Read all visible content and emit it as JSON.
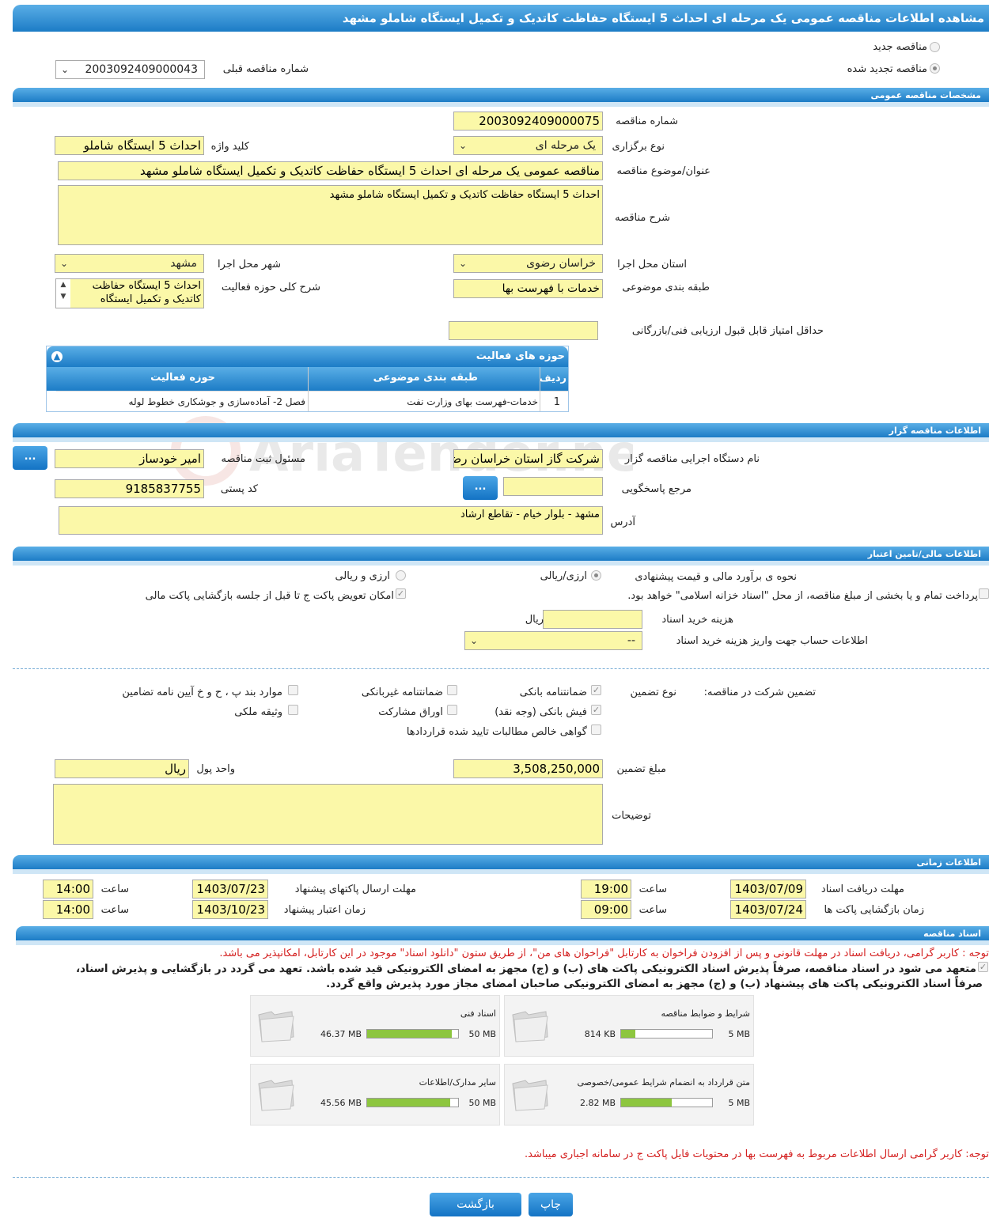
{
  "header": {
    "title": "مشاهده اطلاعات مناقصه عمومی یک مرحله ای احداث 5 ایستگاه حفاظت کاتدیک و تکمیل ایستگاه شاملو مشهد"
  },
  "top": {
    "new_tender": "مناقصه جدید",
    "renewed_tender": "مناقصه تجدید شده",
    "prev_number_label": "شماره مناقصه قبلی",
    "prev_number_value": "2003092409000043"
  },
  "general": {
    "section_title": "مشخصات مناقصه عمومی",
    "number_label": "شماره مناقصه",
    "number_value": "2003092409000075",
    "type_label": "نوع برگزاری",
    "type_value": "یک مرحله ای",
    "keyword_label": "کلید واژه",
    "keyword_value": "احداث 5 ایستگاه شاملو",
    "subject_label": "عنوان/موضوع مناقصه",
    "subject_value": "مناقصه عمومی یک مرحله ای احداث 5 ایستگاه حفاظت کاتدیک و تکمیل ایستگاه شاملو مشهد",
    "desc_label": "شرح مناقصه",
    "desc_value": "احداث 5 ایستگاه حفاظت کاتدیک و تکمیل ایستگاه شاملو مشهد",
    "province_label": "استان محل اجرا",
    "province_value": "خراسان رضوی",
    "city_label": "شهر محل اجرا",
    "city_value": "مشهد",
    "category_label": "طبقه بندی موضوعی",
    "category_value": "خدمات با فهرست بها",
    "activity_desc_label": "شرح کلی حوزه فعالیت",
    "activity_desc_value": "احداث 5 ایستگاه حفاظت کاتدیک و تکمیل ایستگاه",
    "min_score_label": "حداقل امتیاز قابل قبول ارزیابی فنی/بازرگانی"
  },
  "activity_grid": {
    "title": "حوزه های فعالیت",
    "headers": [
      "ردیف",
      "طبقه بندی موضوعی",
      "حوزه فعالیت"
    ],
    "rows": [
      [
        "1",
        "خدمات-فهرست بهای وزارت نفت",
        "فصل 2- آماده‌سازی و جوشکاری خطوط لوله"
      ]
    ]
  },
  "organizer": {
    "section_title": "اطلاعات مناقصه گزار",
    "org_label": "نام دستگاه اجرایی مناقصه گزار",
    "org_value": "شرکت گاز استان خراسان رضوی",
    "responsible_label": "مسئول ثبت مناقصه",
    "responsible_value": "امیر خودساز",
    "ref_label": "مرجع پاسخگویی",
    "postal_label": "کد پستی",
    "postal_value": "9185837755",
    "address_label": "آدرس",
    "address_value": "مشهد - بلوار خیام - تقاطع ارشاد",
    "dots": "..."
  },
  "financial": {
    "section_title": "اطلاعات مالی/تامین اعتبار",
    "estimate_label": "نحوه ی برآورد مالی و قیمت پیشنهادی",
    "opt_rial": "ارزی/ریالی",
    "opt_currency": "ارزی و ریالی",
    "treasury_text": "پرداخت تمام و یا بخشی از مبلغ مناقصه، از محل \"اسناد خزانه اسلامی\" خواهد بود.",
    "swap_text": "امکان تعویض پاکت ج تا قبل از جلسه بازگشایی پاکت مالی",
    "doc_cost_label": "هزینه خرید اسناد",
    "doc_cost_unit": "ریال",
    "account_label": "اطلاعات حساب جهت واریز هزینه خرید اسناد",
    "account_value": "--"
  },
  "guarantee": {
    "label": "تضمین شرکت در مناقصه:",
    "type_label": "نوع تضمین",
    "bank_guarantee": "ضمانتنامه بانکی",
    "non_bank_guarantee": "ضمانتنامه غیربانکی",
    "clauses": "موارد بند پ ، ح و خ آیین نامه تضامین",
    "bank_receipt": "فیش بانکی (وجه نقد)",
    "bonds": "اوراق مشارکت",
    "property": "وثیقه ملکی",
    "certificate": "گواهی خالص مطالبات تایید شده قراردادها",
    "amount_label": "مبلغ تضمین",
    "amount_value": "3,508,250,000",
    "currency_label": "واحد پول",
    "currency_value": "ریال",
    "notes_label": "توضیحات"
  },
  "timing": {
    "section_title": "اطلاعات زمانی",
    "doc_receive_label": "مهلت دریافت اسناد",
    "doc_receive_date": "1403/07/09",
    "doc_receive_time": "19:00",
    "submit_label": "مهلت ارسال پاکتهای پیشنهاد",
    "submit_date": "1403/07/23",
    "submit_time": "14:00",
    "opening_label": "زمان بازگشایی پاکت ها",
    "opening_date": "1403/07/24",
    "opening_time": "09:00",
    "validity_label": "زمان اعتبار پیشنهاد",
    "validity_date": "1403/10/23",
    "validity_time": "14:00",
    "time_label": "ساعت"
  },
  "documents": {
    "section_title": "اسناد مناقصه",
    "notice": "توجه : کاربر گرامی، دریافت اسناد در مهلت قانونی و پس از افزودن فراخوان به کارتابل \"فراخوان های من\"، از طریق ستون \"دانلود اسناد\" موجود در این کارتابل، امکانپذیر می باشد.",
    "commit_line1": "متعهد می شود در اسناد مناقصه، صرفاً پذیرش اسناد الکترونیکی پاکت های (ب) و (ج) مجهز به امضای الکترونیکی قید شده باشد. تعهد می گردد در بازگشایی و پذیرش اسناد،",
    "commit_line2": "صرفاً اسناد الکترونیکی پاکت های پیشنهاد (ب) و (ج) مجهز به امضای الکترونیکی صاحبان امضای مجاز مورد پذیرش واقع گردد.",
    "files": [
      {
        "title": "شرایط و ضوابط مناقصه",
        "used": "814 KB",
        "max": "5 MB",
        "fraction": 0.16
      },
      {
        "title": "اسناد فنی",
        "used": "46.37 MB",
        "max": "50 MB",
        "fraction": 0.93
      },
      {
        "title": "متن قرارداد به انضمام شرایط عمومی/خصوصی",
        "used": "2.82 MB",
        "max": "5 MB",
        "fraction": 0.56
      },
      {
        "title": "سایر مدارک/اطلاعات",
        "used": "45.56 MB",
        "max": "50 MB",
        "fraction": 0.91
      }
    ],
    "bottom_notice": "توجه: کاربر گرامی ارسال اطلاعات مربوط به فهرست بها در محتویات فایل پاکت ج در سامانه اجباری میباشد."
  },
  "buttons": {
    "print": "چاپ",
    "back": "بازگشت"
  },
  "colors": {
    "header_blue": "#1c7cc6",
    "field_yellow": "#fbf8a8",
    "notice_red": "#d42020",
    "progress_green": "#8dc63f"
  }
}
